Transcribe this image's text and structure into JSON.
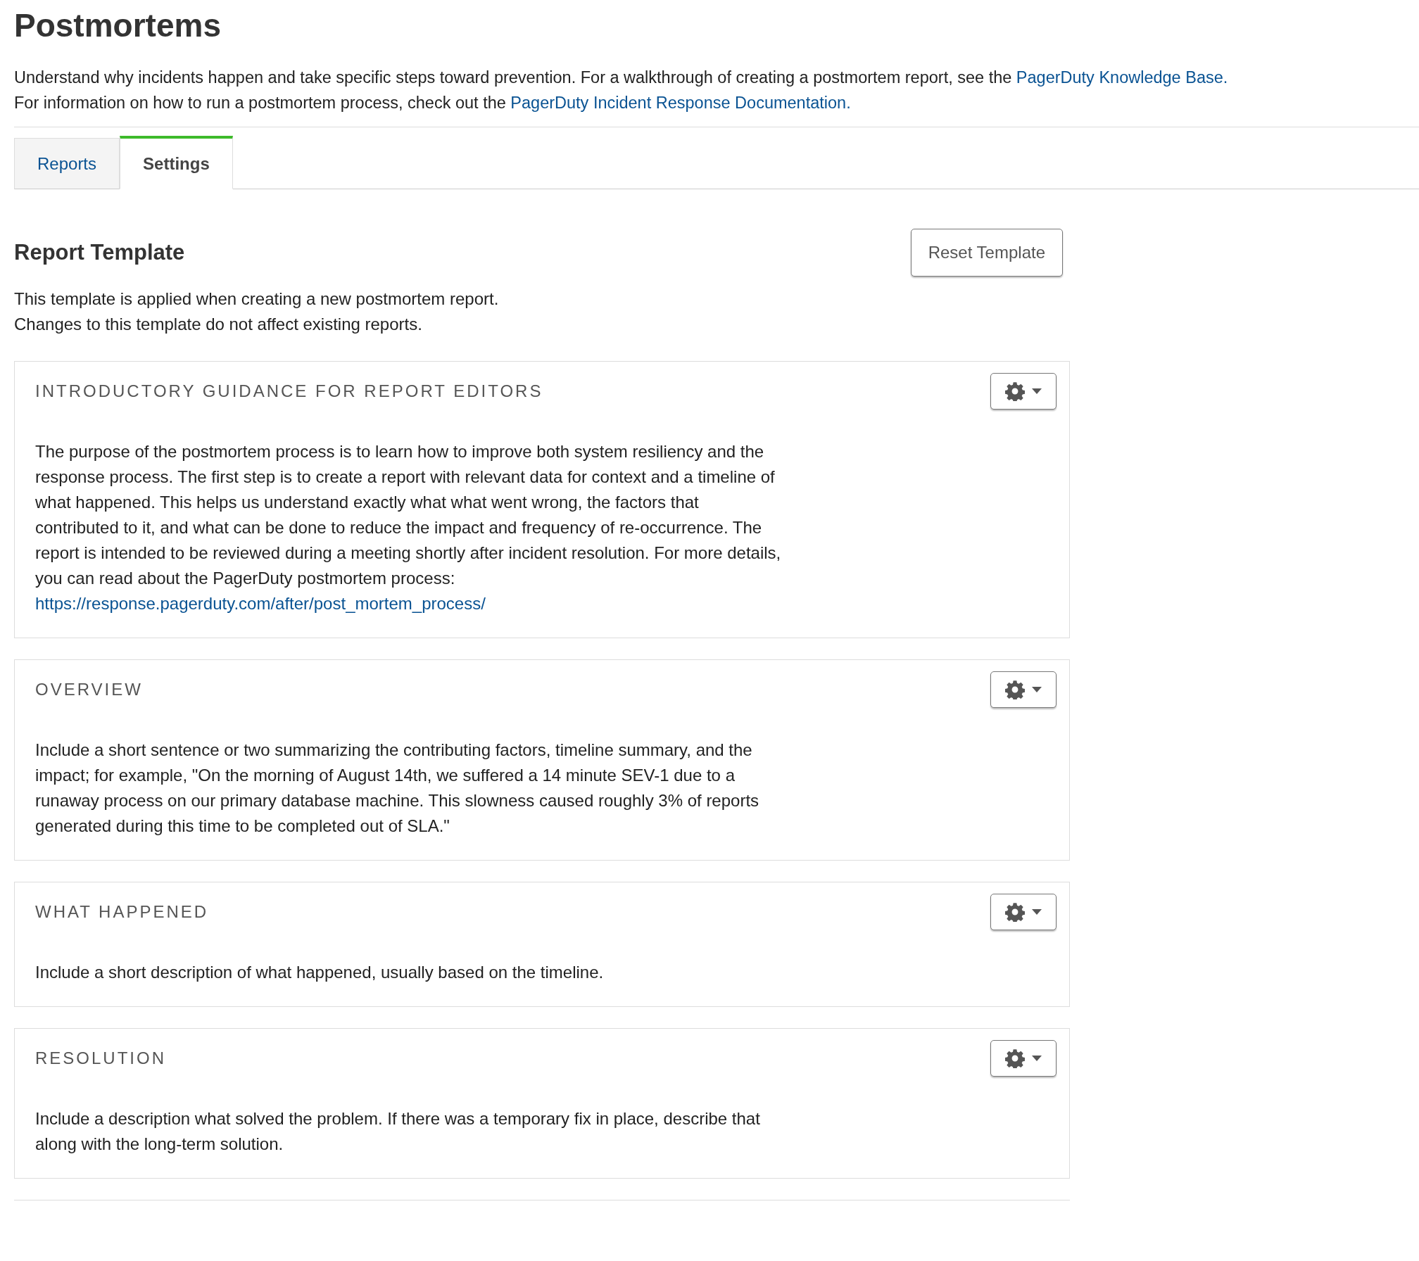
{
  "page_title": "Postmortems",
  "intro": [
    {
      "text": "Understand why incidents happen and take specific steps toward prevention. For a walkthrough of creating a postmortem report, see the ",
      "link": "PagerDuty Knowledge Base."
    },
    {
      "text": "For information on how to run a postmortem process, check out the ",
      "link": "PagerDuty Incident Response Documentation."
    }
  ],
  "tabs": [
    {
      "label": "Reports",
      "selected": false
    },
    {
      "label": "Settings",
      "selected": true
    }
  ],
  "section": {
    "title": "Report Template",
    "reset_button": "Reset Template",
    "description": [
      "This template is applied when creating a new postmortem report.",
      "Changes to this template do not affect existing reports."
    ]
  },
  "template_sections": [
    {
      "heading": "INTRODUCTORY GUIDANCE FOR REPORT EDITORS",
      "body": "The purpose of the postmortem process is to learn how to improve both system resiliency and the response process. The first step is to create a report with relevant data for context and a timeline of what happened. This helps us understand exactly what what went wrong, the factors that contributed to it, and what can be done to reduce the impact and frequency of re-occurrence. The report is intended to be reviewed during a meeting shortly after incident resolution. For more details, you can read about the PagerDuty postmortem process:",
      "link": "https://response.pagerduty.com/after/post_mortem_process/"
    },
    {
      "heading": "OVERVIEW",
      "body": "Include a short sentence or two summarizing the contributing factors, timeline summary, and the impact; for example, \"On the morning of August 14th, we suffered a 14 minute SEV-1 due to a runaway process on our primary database machine. This slowness caused roughly 3% of reports generated during this time to be completed out of SLA.\""
    },
    {
      "heading": "WHAT HAPPENED",
      "body": "Include a short description of what happened, usually based on the timeline."
    },
    {
      "heading": "RESOLUTION",
      "body": "Include a description what solved the problem. If there was a temporary fix in place, describe that along with the long-term solution."
    }
  ]
}
